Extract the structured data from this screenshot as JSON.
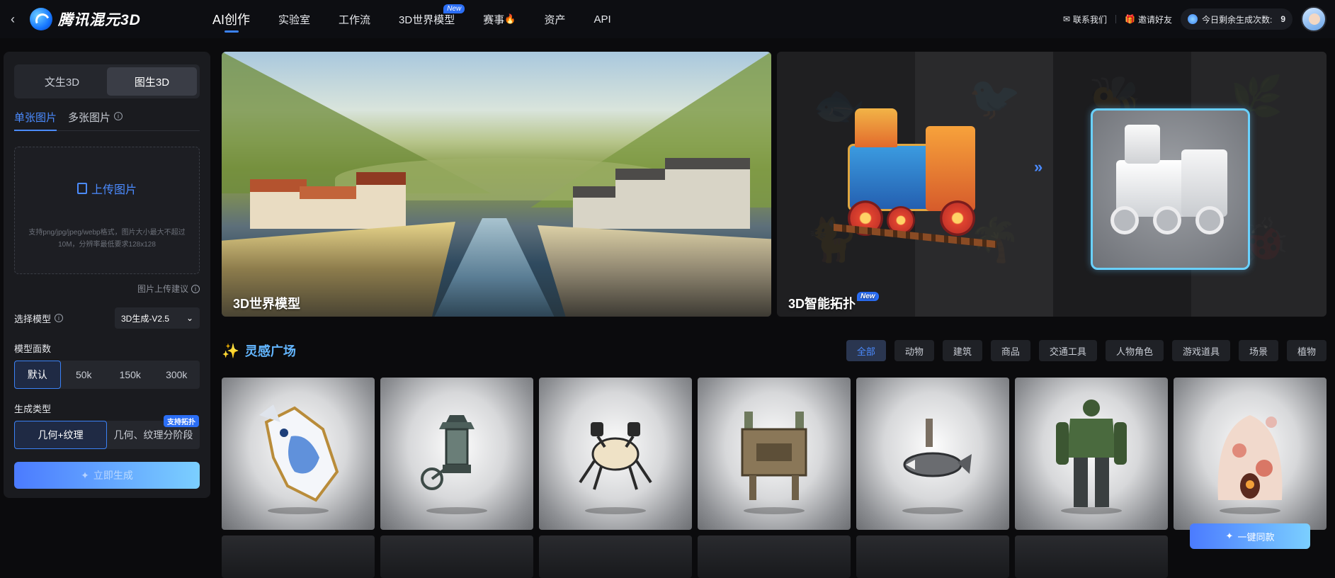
{
  "header": {
    "logo_text": "腾讯混元3D",
    "nav": [
      {
        "label": "AI创作",
        "active": true
      },
      {
        "label": "实验室"
      },
      {
        "label": "工作流"
      },
      {
        "label": "3D世界模型",
        "badge": "New"
      },
      {
        "label": "赛事"
      },
      {
        "label": "资产"
      },
      {
        "label": "API"
      }
    ],
    "contact": "联系我们",
    "invite": "邀请好友",
    "credits_label": "今日剩余生成次数:",
    "credits_value": "9"
  },
  "sidebar": {
    "mode_tabs": [
      "文生3D",
      "图生3D"
    ],
    "active_mode": "图生3D",
    "image_tabs": [
      "单张图片",
      "多张图片"
    ],
    "upload_label": "上传图片",
    "upload_hint": "支持png/jpg/jpeg/webp格式，图片大小最大不超过10M，分辨率最低要求128x128",
    "upload_tip": "图片上传建议",
    "model_label": "选择模型",
    "model_value": "3D生成-V2.5",
    "faces_label": "模型面数",
    "faces_options": [
      "默认",
      "50k",
      "150k",
      "300k"
    ],
    "gen_type_label": "生成类型",
    "gen_type_options": [
      "几何+纹理",
      "几何、纹理分阶段"
    ],
    "gen_type_badge": "支持拓扑",
    "generate_button": "立即生成"
  },
  "banners": [
    {
      "title": "3D世界模型"
    },
    {
      "title": "3D智能拓扑",
      "badge": "New"
    }
  ],
  "inspiration": {
    "title": "灵感广场",
    "filters": [
      "全部",
      "动物",
      "建筑",
      "商品",
      "交通工具",
      "人物角色",
      "游戏道具",
      "场景",
      "植物"
    ],
    "active_filter": "全部"
  },
  "gallery": {
    "items": [
      {
        "name": "blue-white-porcelain-horse-head"
      },
      {
        "name": "lantern-cart"
      },
      {
        "name": "mechanical-crab"
      },
      {
        "name": "bronze-ding-vessel"
      },
      {
        "name": "mechanical-fish"
      },
      {
        "name": "armored-giant-figure"
      },
      {
        "name": "shell-fairy-house"
      }
    ]
  },
  "one_click_button": "一键同款",
  "colors": {
    "accent": "#3b82f6",
    "title_blue": "#63b6ff",
    "background": "#0b0b0d",
    "panel": "#1a1b1f"
  }
}
